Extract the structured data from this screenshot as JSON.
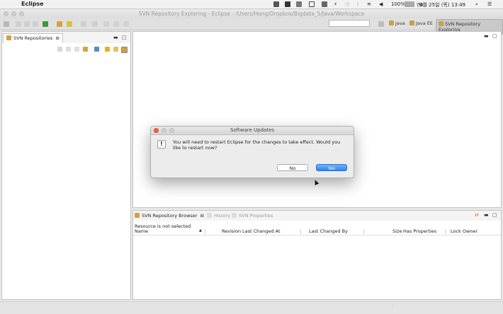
{
  "menubar": {
    "app_name": "Eclipse",
    "battery": "100%",
    "input_method": "한A",
    "datetime": "6월 25일 (목)  13:49"
  },
  "window": {
    "title": "SVN Repository Exploring - Eclipse - /Users/Hong/Dropbox/Bigdata_5/Java/Workspace"
  },
  "perspectives": {
    "java": "Java",
    "java_ee": "Java EE",
    "svn": "SVN Repository Exploring"
  },
  "left_panel": {
    "tab_label": "SVN Repositories"
  },
  "bottom_panel": {
    "tabs": [
      "SVN Repository Browser",
      "History",
      "SVN Properties"
    ],
    "status_text": "Resource is not selected",
    "columns": [
      "Name",
      "Revision",
      "Last Changed At",
      "Last Changed By",
      "Size",
      "Has Properties",
      "Lock Owner"
    ]
  },
  "dialog": {
    "title": "Software Updates",
    "message": "You will need to restart Eclipse for the changes to take effect. Would you like to restart now?",
    "no_label": "No",
    "yes_label": "Yes"
  }
}
